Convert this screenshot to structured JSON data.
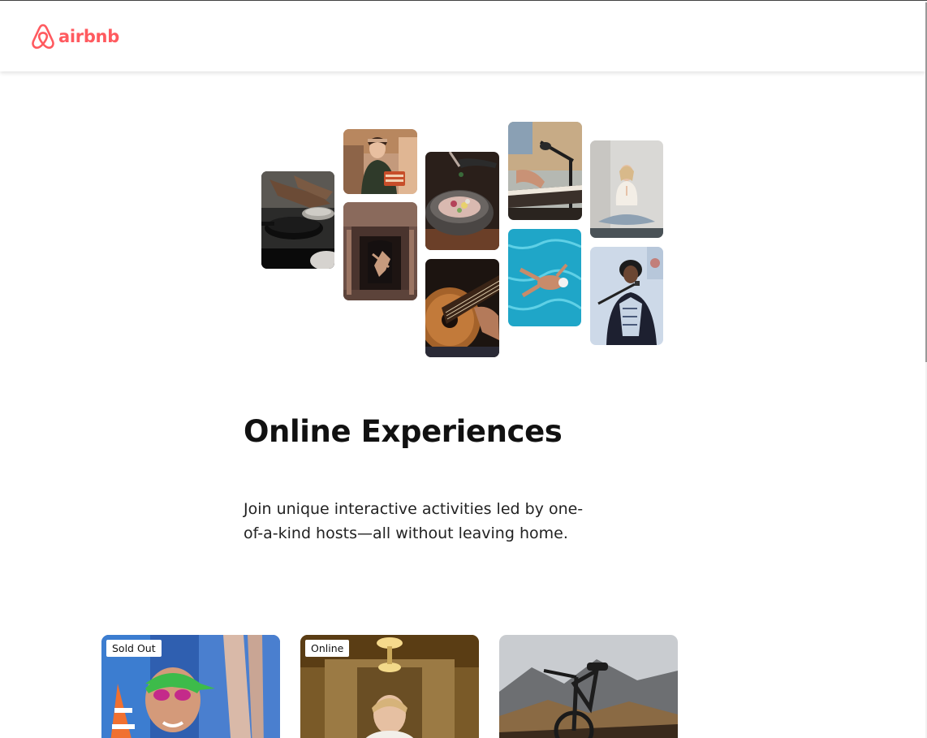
{
  "navbar": {
    "logo_text": "airbnb",
    "brand_color": "#ff5a5f"
  },
  "hero": {
    "photo_grid": [
      {
        "name": "cooking-pans-photo",
        "subject": "cooking pans"
      },
      {
        "name": "chef-woman-photo",
        "subject": "woman holding food"
      },
      {
        "name": "dancer-photo",
        "subject": "dancer in doorway"
      },
      {
        "name": "food-bowl-photo",
        "subject": "food bowl"
      },
      {
        "name": "guitar-photo",
        "subject": "guitar"
      },
      {
        "name": "piano-microphone-photo",
        "subject": "piano and microphone"
      },
      {
        "name": "swimmer-photo",
        "subject": "swimmer"
      },
      {
        "name": "yoga-photo",
        "subject": "yoga"
      },
      {
        "name": "singer-photo",
        "subject": "singer"
      }
    ]
  },
  "main": {
    "title": "Online Experiences",
    "description": "Join unique interactive activities led by one-of-a-kind hosts—all without leaving home."
  },
  "cards": [
    {
      "badge": "Sold Out",
      "subject": "swimmer with goggles"
    },
    {
      "badge": "Online",
      "subject": "woman in wedding dress"
    },
    {
      "badge": "",
      "subject": "mountain bike"
    }
  ]
}
